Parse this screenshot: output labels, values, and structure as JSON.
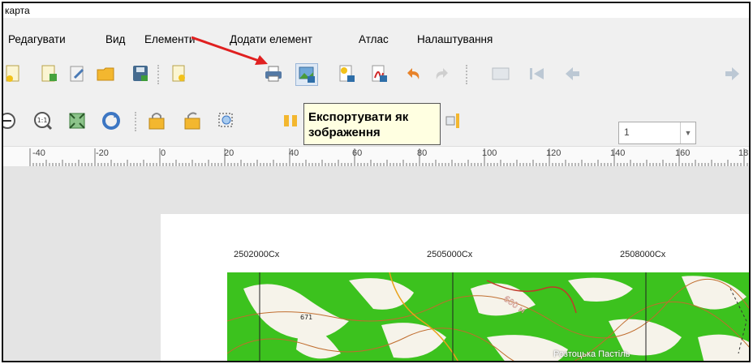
{
  "window": {
    "title": "карта"
  },
  "menu": {
    "items": [
      "Редагувати",
      "Вид",
      "Елементи",
      "Додати елемент",
      "Атлас",
      "Налаштування"
    ]
  },
  "toolbar1": {
    "icons": [
      "new-layout-icon",
      "duplicate-layout-icon",
      "layout-manager-icon",
      "open-template-icon",
      "save-icon",
      "new-page-icon",
      "print-icon",
      "export-image-icon",
      "export-svg-icon",
      "export-pdf-icon",
      "undo-icon",
      "redo-icon",
      "atlas-preview-icon",
      "first-feature-icon",
      "previous-feature-icon",
      "next-feature-icon"
    ],
    "page_value": "1"
  },
  "toolbar2": {
    "icons": [
      "zoom-out-icon",
      "zoom-actual-icon",
      "zoom-full-icon",
      "refresh-icon",
      "lock-icon",
      "unlock-icon",
      "select-icon",
      "move-content-icon",
      "align-icon"
    ]
  },
  "tooltip": {
    "line1": "Експортувати як",
    "line2": "зображення"
  },
  "ruler": {
    "labels": [
      "-40",
      "-20",
      "0",
      "20",
      "40",
      "60",
      "80",
      "100",
      "120",
      "140",
      "160",
      "18"
    ]
  },
  "map": {
    "coords": [
      "2502000Cx",
      "2505000Cx",
      "2508000Cx"
    ],
    "labels": {
      "village": "Розтоцька Пастіль",
      "contour": "600 м",
      "spot": "671"
    },
    "colors": {
      "forest": "#3cc21e",
      "clearing": "#f6f3ea",
      "contour": "#c06d2e",
      "road": "#e8a21a"
    }
  }
}
